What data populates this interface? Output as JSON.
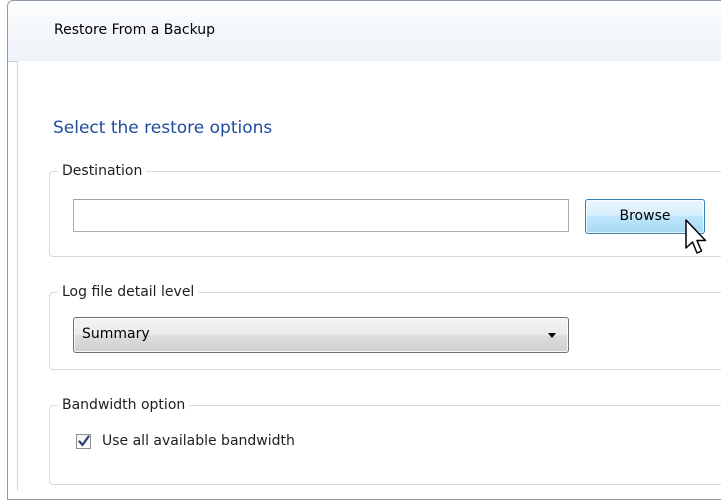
{
  "window": {
    "title": "Restore From a Backup"
  },
  "main": {
    "heading": "Select the restore options",
    "destination": {
      "group_label": "Destination",
      "path_value": "",
      "browse_label": "Browse"
    },
    "log_level": {
      "group_label": "Log file detail level",
      "selected": "Summary"
    },
    "bandwidth": {
      "group_label": "Bandwidth option",
      "checkbox_label": "Use all available bandwidth",
      "checked": true
    }
  },
  "colors": {
    "heading": "#1f4b9e",
    "button_border": "#3c7fb1",
    "checkmark": "#2a3f7a"
  }
}
